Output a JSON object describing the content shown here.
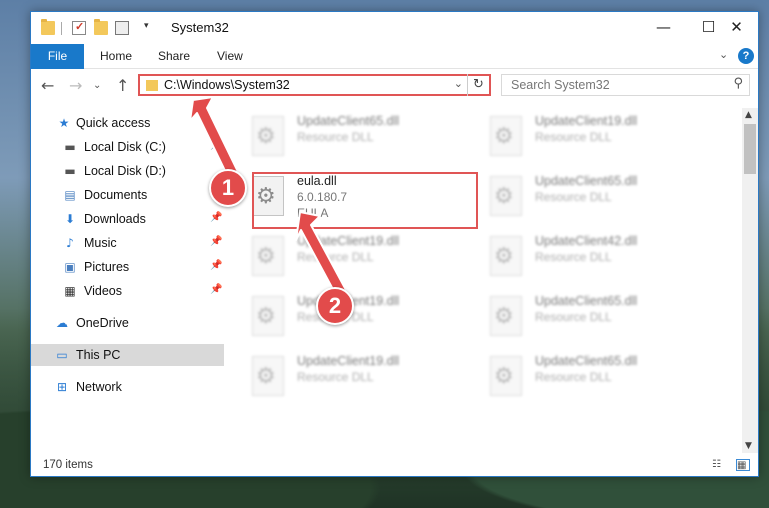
{
  "window": {
    "title": "System32",
    "controls": {
      "minimize": "—",
      "maximize": "☐",
      "close": "✕"
    }
  },
  "ribbon": {
    "file": "File",
    "tabs": [
      "Home",
      "Share",
      "View"
    ],
    "help": "?",
    "expand": "⌄"
  },
  "nav": {
    "back": "←",
    "forward": "→",
    "recent": "⌄",
    "up": "↑",
    "address": "C:\\Windows\\System32",
    "address_dropdown": "⌄",
    "refresh": "↻",
    "search_placeholder": "Search System32",
    "search_icon": "⚲"
  },
  "sidebar": {
    "items": [
      {
        "label": "Quick access",
        "icon": "star-icon",
        "glyph": "★",
        "color": "#2b7cd3"
      },
      {
        "label": "Local Disk (C:)",
        "icon": "drive-icon",
        "glyph": "▬",
        "color": "#555555"
      },
      {
        "label": "Local Disk (D:)",
        "icon": "drive-icon",
        "glyph": "▬",
        "color": "#555555"
      },
      {
        "label": "Documents",
        "icon": "documents-icon",
        "glyph": "▤",
        "color": "#4a7fbf"
      },
      {
        "label": "Downloads",
        "icon": "download-arrow-icon",
        "glyph": "⬇",
        "color": "#2b7cd3"
      },
      {
        "label": "Music",
        "icon": "music-note-icon",
        "glyph": "♪",
        "color": "#2b7cd3"
      },
      {
        "label": "Pictures",
        "icon": "pictures-icon",
        "glyph": "▣",
        "color": "#4a7fbf"
      },
      {
        "label": "Videos",
        "icon": "film-icon",
        "glyph": "▦",
        "color": "#333333"
      },
      {
        "label": "OneDrive",
        "icon": "cloud-icon",
        "glyph": "☁",
        "color": "#2b7cd3"
      },
      {
        "label": "This PC",
        "icon": "monitor-icon",
        "glyph": "▭",
        "color": "#2b7cd3"
      },
      {
        "label": "Network",
        "icon": "network-icon",
        "glyph": "⊞",
        "color": "#2b7cd3"
      }
    ],
    "pin": "📌"
  },
  "files": [
    {
      "name": "UpdateClient65.dll",
      "line2": "Resource DLL",
      "line3": ""
    },
    {
      "name": "UpdateClient19.dll",
      "line2": "Resource DLL",
      "line3": ""
    },
    {
      "name": "eula.dll",
      "line2": "6.0.180.7",
      "line3": "EULA"
    },
    {
      "name": "UpdateClient65.dll",
      "line2": "Resource DLL",
      "line3": ""
    },
    {
      "name": "UpdateClient19.dll",
      "line2": "Resource DLL",
      "line3": ""
    },
    {
      "name": "UpdateClient42.dll",
      "line2": "Resource DLL",
      "line3": ""
    },
    {
      "name": "UpdateClient19.dll",
      "line2": "Resource DLL",
      "line3": ""
    },
    {
      "name": "UpdateClient65.dll",
      "line2": "Resource DLL",
      "line3": ""
    },
    {
      "name": "UpdateClient19.dll",
      "line2": "Resource DLL",
      "line3": ""
    },
    {
      "name": "UpdateClient65.dll",
      "line2": "Resource DLL",
      "line3": ""
    }
  ],
  "status": {
    "count": "170 items"
  },
  "annotations": {
    "step1": "1",
    "step2": "2",
    "color": "#e24b4b"
  }
}
